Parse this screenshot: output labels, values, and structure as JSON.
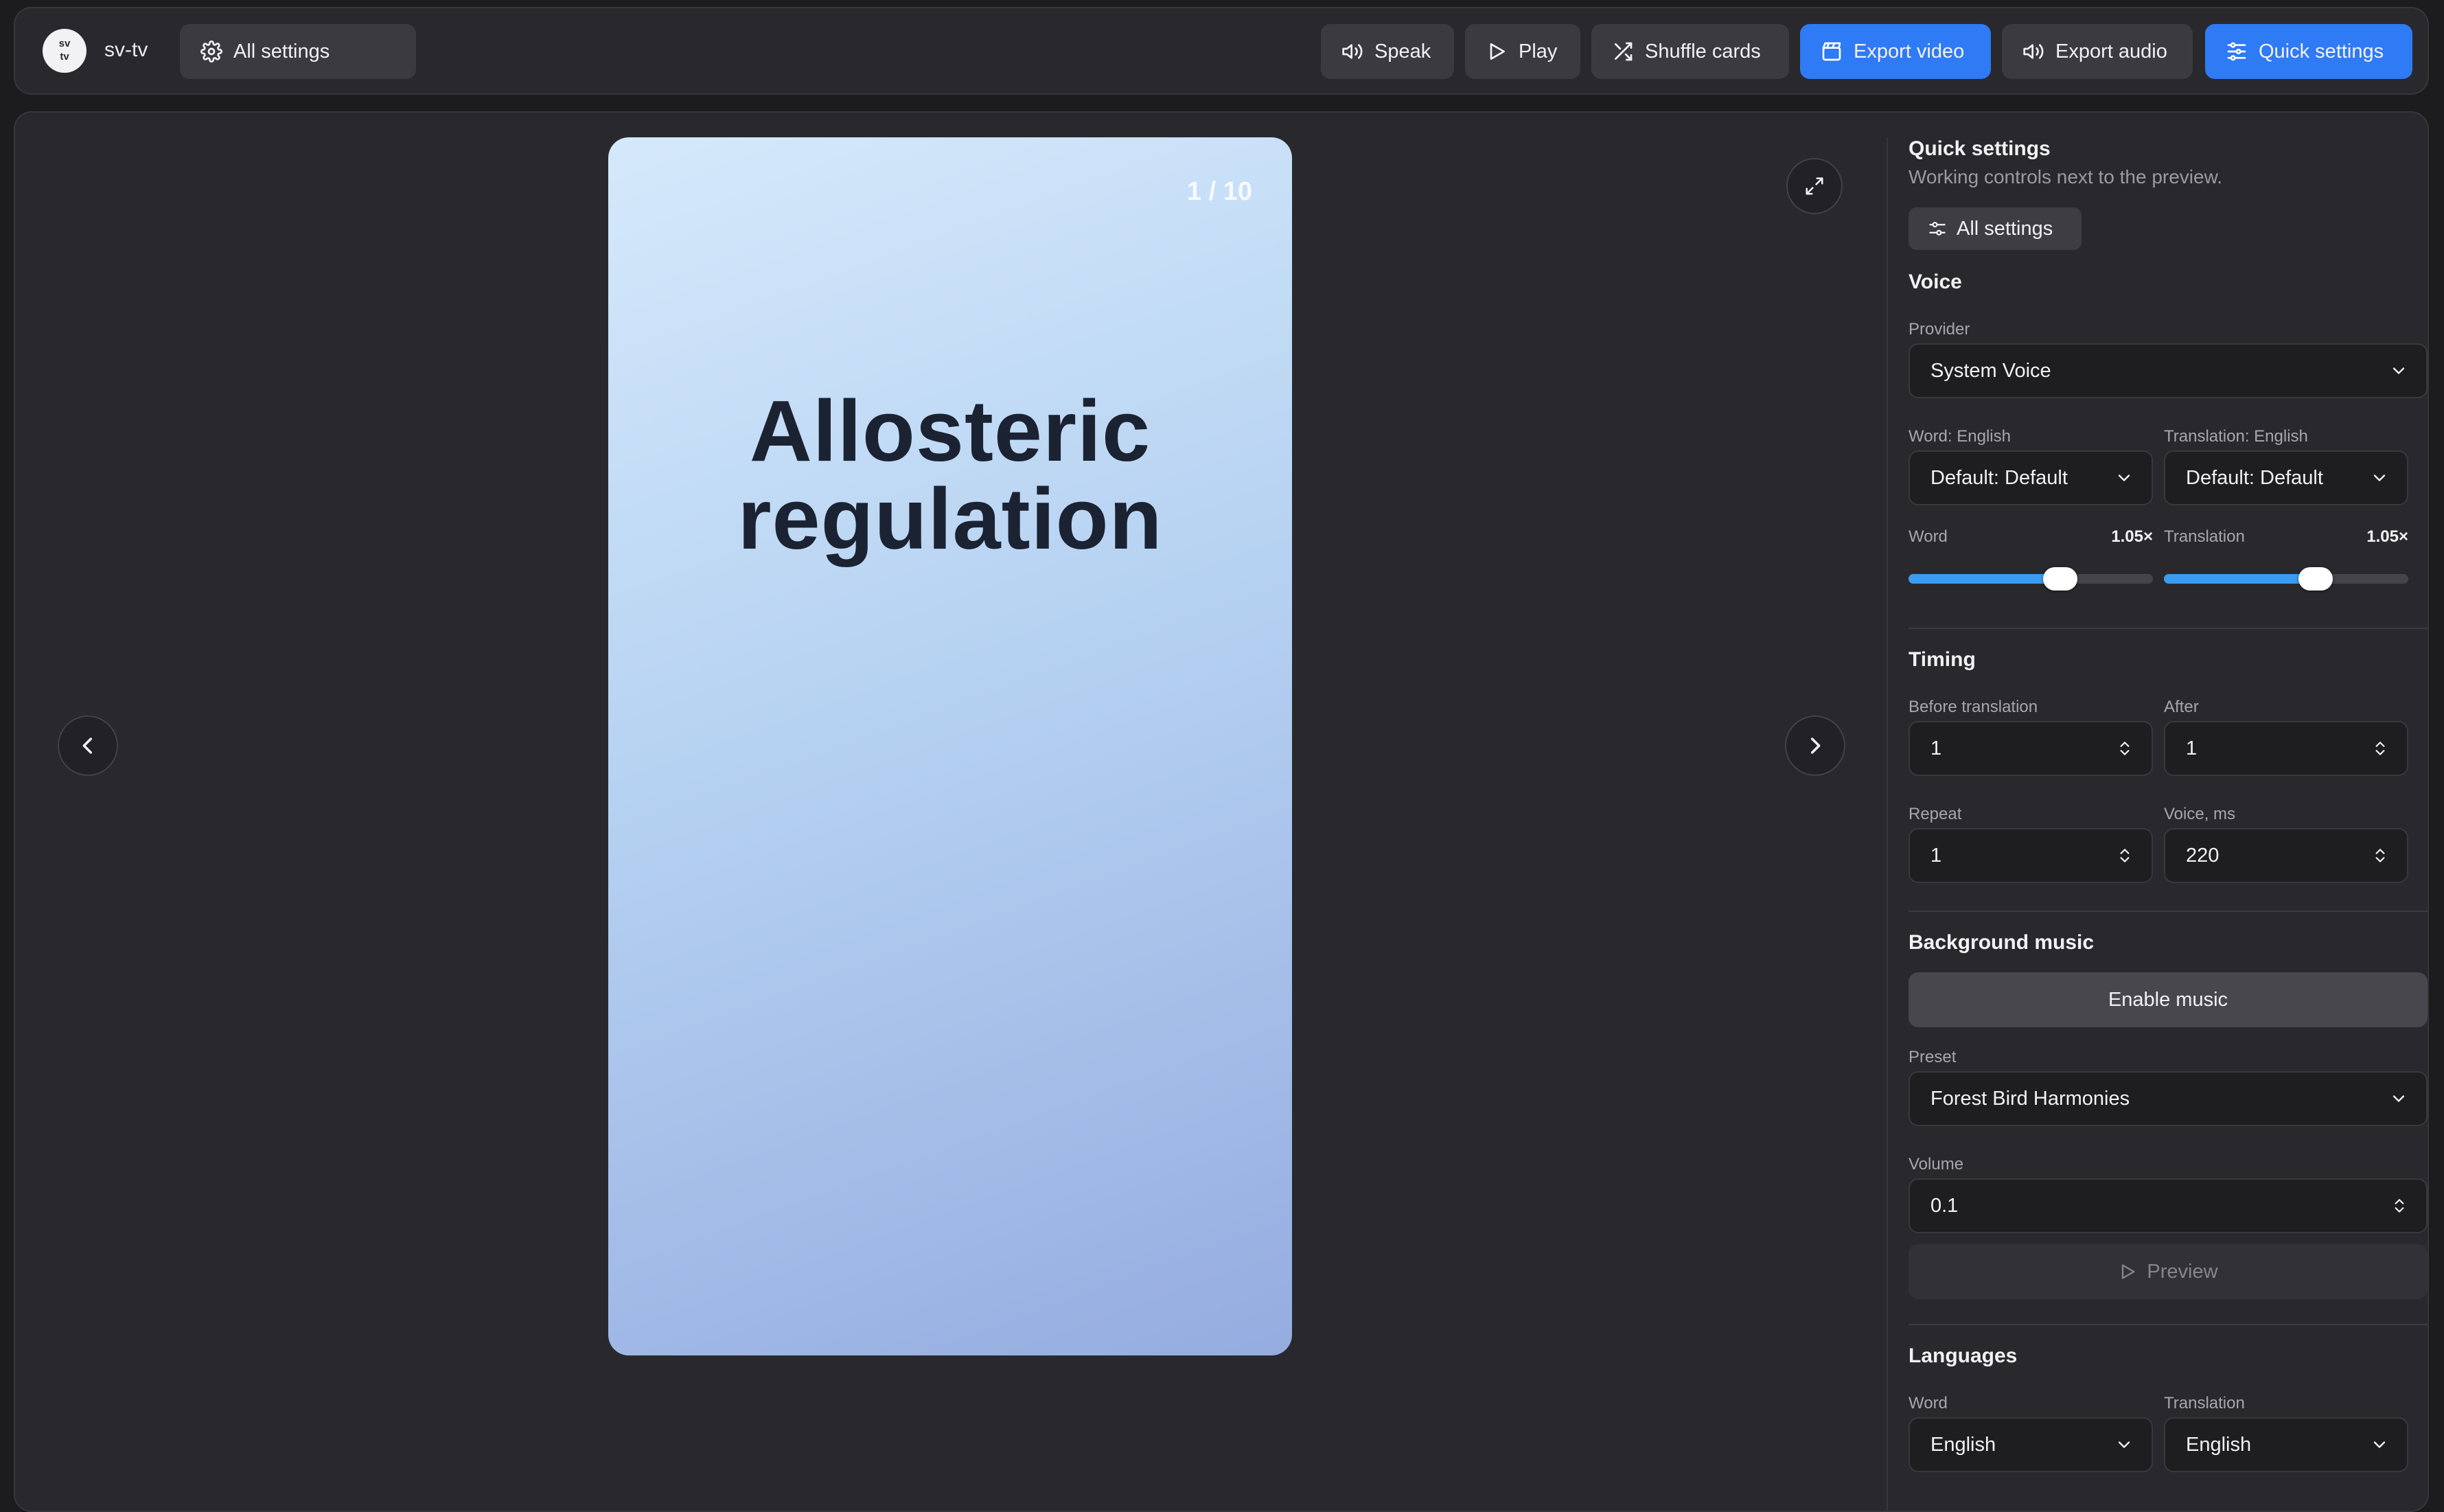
{
  "app": {
    "logo_text": "sv\ntv",
    "name": "sv-tv"
  },
  "toolbar": {
    "all_settings": "All settings",
    "speak": "Speak",
    "play": "Play",
    "shuffle": "Shuffle cards",
    "export_video": "Export video",
    "export_audio": "Export audio",
    "quick_settings": "Quick settings"
  },
  "card": {
    "counter": "1 / 10",
    "word_line1": "Allosteric",
    "word_line2": "regulation"
  },
  "quick_settings": {
    "title": "Quick settings",
    "subtitle": "Working controls next to the preview.",
    "all_settings_button": "All settings",
    "voice": {
      "heading": "Voice",
      "provider_label": "Provider",
      "provider_value": "System Voice",
      "word_voice_label": "Word: English",
      "word_voice_value": "Default: Default",
      "translation_voice_label": "Translation: English",
      "translation_voice_value": "Default: Default",
      "word_speed_label": "Word",
      "word_speed_value": "1.05×",
      "word_speed_fraction": 0.62,
      "translation_speed_label": "Translation",
      "translation_speed_value": "1.05×",
      "translation_speed_fraction": 0.62
    },
    "timing": {
      "heading": "Timing",
      "before_label": "Before translation",
      "before_value": "1",
      "after_label": "After",
      "after_value": "1",
      "repeat_label": "Repeat",
      "repeat_value": "1",
      "voice_ms_label": "Voice, ms",
      "voice_ms_value": "220"
    },
    "music": {
      "heading": "Background music",
      "enable_button": "Enable music",
      "preset_label": "Preset",
      "preset_value": "Forest Bird Harmonies",
      "volume_label": "Volume",
      "volume_value": "0.1",
      "preview_button": "Preview"
    },
    "languages": {
      "heading": "Languages",
      "word_label": "Word",
      "word_value": "English",
      "translation_label": "Translation",
      "translation_value": "English"
    }
  },
  "colors": {
    "accent": "#2f7af5",
    "slider": "#3a9bf2",
    "background": "#1c1c1f",
    "panel": "#29292d"
  }
}
